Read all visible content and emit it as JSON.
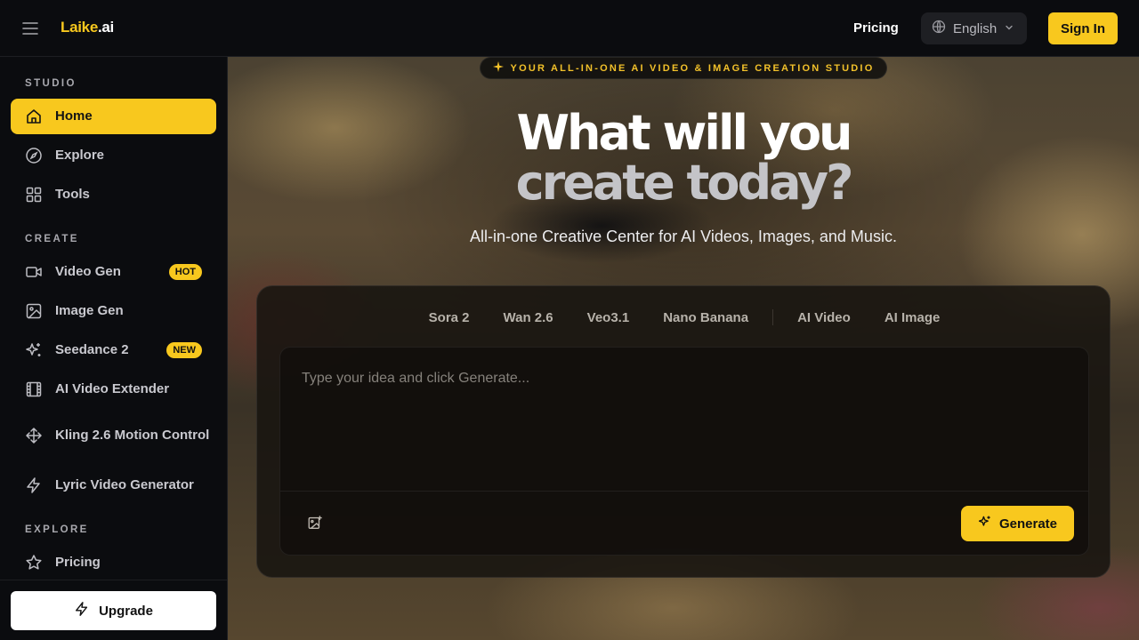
{
  "header": {
    "menu_icon": "hamburger-icon",
    "logo_brand": "Laike",
    "logo_tld": ".ai",
    "pricing_label": "Pricing",
    "language": "English",
    "signin_label": "Sign In"
  },
  "sidebar": {
    "sections": {
      "studio": "STUDIO",
      "create": "CREATE",
      "explore": "EXPLORE"
    },
    "studio_items": [
      {
        "label": "Home",
        "icon": "home-icon",
        "active": true
      },
      {
        "label": "Explore",
        "icon": "compass-icon"
      },
      {
        "label": "Tools",
        "icon": "grid-icon"
      }
    ],
    "create_items": [
      {
        "label": "Video Gen",
        "icon": "video-icon",
        "badge": "HOT"
      },
      {
        "label": "Image Gen",
        "icon": "image-icon"
      },
      {
        "label": "Seedance 2",
        "icon": "sparkles-icon",
        "badge": "NEW"
      },
      {
        "label": "AI Video Extender",
        "icon": "film-icon"
      },
      {
        "label": "Kling 2.6 Motion Control",
        "icon": "move-icon"
      },
      {
        "label": "Lyric Video Generator",
        "icon": "zap-icon"
      }
    ],
    "explore_items": [
      {
        "label": "Pricing",
        "icon": "star-icon"
      }
    ],
    "upgrade_label": "Upgrade"
  },
  "hero": {
    "tagline": "YOUR ALL-IN-ONE AI VIDEO & IMAGE CREATION STUDIO",
    "headline_line1": "What will you",
    "headline_line2": "create today?",
    "subhead": "All-in-one Creative Center for AI Videos, Images, and Music."
  },
  "panel": {
    "model_tabs": [
      "Sora 2",
      "Wan 2.6",
      "Veo3.1",
      "Nano Banana"
    ],
    "type_tabs": [
      "AI Video",
      "AI Image"
    ],
    "prompt_placeholder": "Type your idea and click Generate...",
    "generate_label": "Generate"
  },
  "colors": {
    "accent": "#f8c81e",
    "background": "#0b0c0f"
  }
}
